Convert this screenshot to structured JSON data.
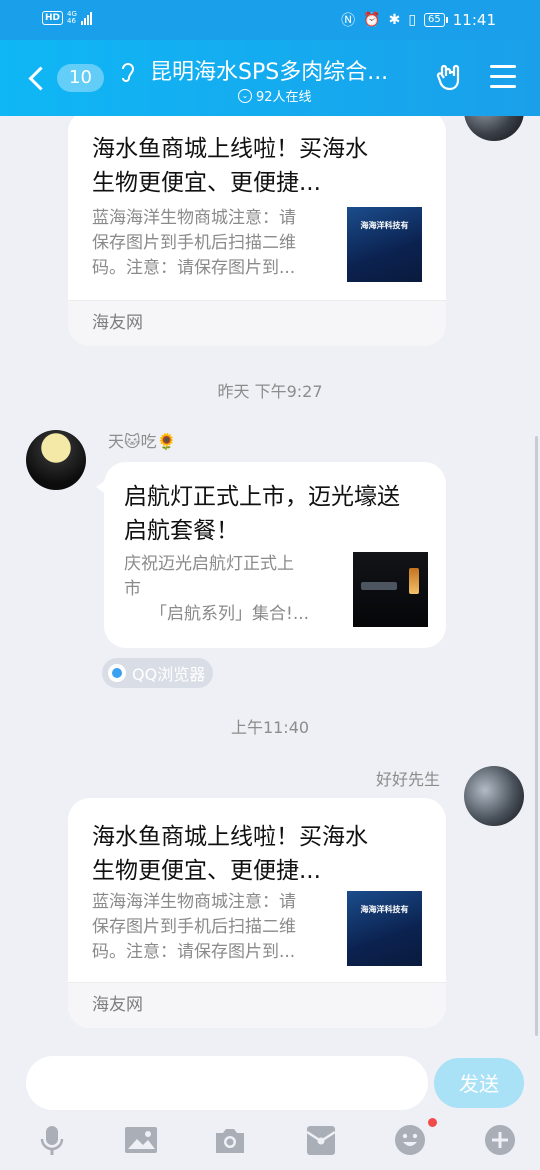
{
  "status": {
    "hd": "HD",
    "net_top": "4G",
    "net_bottom": "46",
    "battery": "65",
    "time": "11:41"
  },
  "header": {
    "unread": "10",
    "title": "昆明海水SPS多肉综合...",
    "online": "92人在线"
  },
  "messages": [
    {
      "title_line1": "海水鱼商城上线啦！买海水",
      "title_line2": "生物更便宜、更便捷...",
      "desc_line1": "蓝海海洋生物商城注意：请",
      "desc_line2": "保存图片到手机后扫描二维",
      "desc_line3": "码。注意：请保存图片到...",
      "thumb_caption": "海海洋科技有",
      "footer": "海友网"
    },
    {
      "time": "昨天 下午9:27",
      "sender": "天🐱吃🌻",
      "title_line1": "启航灯正式上市，迈光壕送",
      "title_line2": "启航套餐！",
      "desc_line1": "庆祝迈光启航灯正式上",
      "desc_line2": "市",
      "desc_line3": "「启航系列」集合!...",
      "source": "QQ浏览器"
    },
    {
      "time": "上午11:40",
      "sender": "好好先生",
      "title_line1": "海水鱼商城上线啦！买海水",
      "title_line2": "生物更便宜、更便捷...",
      "desc_line1": "蓝海海洋生物商城注意：请",
      "desc_line2": "保存图片到手机后扫描二维",
      "desc_line3": "码。注意：请保存图片到...",
      "thumb_caption": "海海洋科技有",
      "footer": "海友网"
    }
  ],
  "input": {
    "placeholder": "",
    "send_label": "发送"
  },
  "toolbar_icons": [
    "microphone-icon",
    "image-icon",
    "camera-icon",
    "red-packet-icon",
    "emoji-icon",
    "plus-icon"
  ],
  "colors": {
    "header": "#1aa0ea",
    "background": "#eef0f5",
    "send_button": "#a9e1f7",
    "notification_dot": "#f04a4a"
  }
}
